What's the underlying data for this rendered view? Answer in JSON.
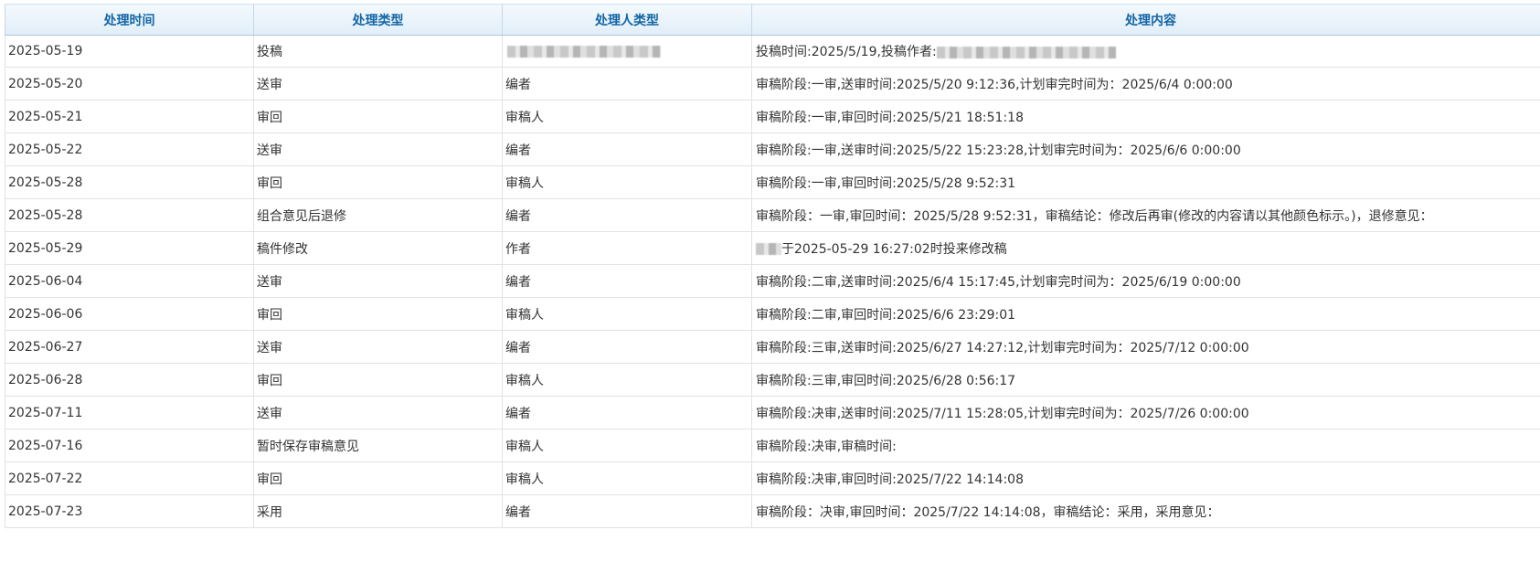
{
  "columns": [
    "处理时间",
    "处理类型",
    "处理人类型",
    "处理内容"
  ],
  "rows": [
    {
      "date": "2025-05-19",
      "type": "投稿",
      "handler": "",
      "handler_redacted": true,
      "content_prefix": "投稿时间:2025/5/19,投稿作者:",
      "content_redacted": true,
      "content_suffix": ""
    },
    {
      "date": "2025-05-20",
      "type": "送审",
      "handler": "编者",
      "content_prefix": "审稿阶段:一审,送审时间:2025/5/20 9:12:36,计划审完时间为：2025/6/4 0:00:00"
    },
    {
      "date": "2025-05-21",
      "type": "审回",
      "handler": "审稿人",
      "content_prefix": "审稿阶段:一审,审回时间:2025/5/21 18:51:18"
    },
    {
      "date": "2025-05-22",
      "type": "送审",
      "handler": "编者",
      "content_prefix": "审稿阶段:一审,送审时间:2025/5/22 15:23:28,计划审完时间为：2025/6/6 0:00:00"
    },
    {
      "date": "2025-05-28",
      "type": "审回",
      "handler": "审稿人",
      "content_prefix": "审稿阶段:一审,审回时间:2025/5/28 9:52:31"
    },
    {
      "date": "2025-05-28",
      "type": "组合意见后退修",
      "handler": "编者",
      "content_prefix": "审稿阶段：一审,审回时间：2025/5/28 9:52:31，审稿结论：修改后再审(修改的内容请以其他颜色标示。)，退修意见："
    },
    {
      "date": "2025-05-29",
      "type": "稿件修改",
      "handler": "作者",
      "content_prefix": "",
      "content_redacted_small": true,
      "content_suffix": "于2025-05-29 16:27:02时投来修改稿"
    },
    {
      "date": "2025-06-04",
      "type": "送审",
      "handler": "编者",
      "content_prefix": "审稿阶段:二审,送审时间:2025/6/4 15:17:45,计划审完时间为：2025/6/19 0:00:00"
    },
    {
      "date": "2025-06-06",
      "type": "审回",
      "handler": "审稿人",
      "content_prefix": "审稿阶段:二审,审回时间:2025/6/6 23:29:01"
    },
    {
      "date": "2025-06-27",
      "type": "送审",
      "handler": "编者",
      "content_prefix": "审稿阶段:三审,送审时间:2025/6/27 14:27:12,计划审完时间为：2025/7/12 0:00:00"
    },
    {
      "date": "2025-06-28",
      "type": "审回",
      "handler": "审稿人",
      "content_prefix": "审稿阶段:三审,审回时间:2025/6/28 0:56:17"
    },
    {
      "date": "2025-07-11",
      "type": "送审",
      "handler": "编者",
      "content_prefix": "审稿阶段:决审,送审时间:2025/7/11 15:28:05,计划审完时间为：2025/7/26 0:00:00"
    },
    {
      "date": "2025-07-16",
      "type": "暂时保存审稿意见",
      "handler": "审稿人",
      "content_prefix": "审稿阶段:决审,审稿时间:"
    },
    {
      "date": "2025-07-22",
      "type": "审回",
      "handler": "审稿人",
      "content_prefix": "审稿阶段:决审,审回时间:2025/7/22 14:14:08"
    },
    {
      "date": "2025-07-23",
      "type": "采用",
      "handler": "编者",
      "content_prefix": "审稿阶段：决审,审回时间：2025/7/22 14:14:08，审稿结论：采用，采用意见："
    }
  ]
}
